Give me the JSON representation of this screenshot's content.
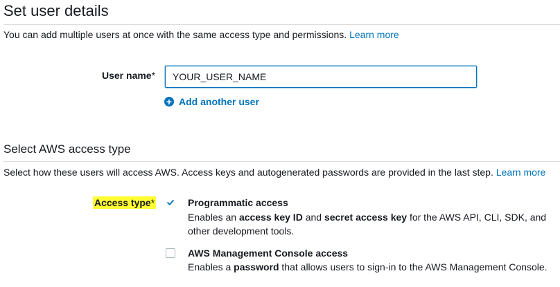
{
  "section1": {
    "title": "Set user details",
    "description": "You can add multiple users at once with the same access type and permissions.",
    "learn_more": "Learn more"
  },
  "user_name": {
    "label": "User name",
    "required_mark": "*",
    "value": "YOUR_USER_NAME"
  },
  "add_user": {
    "label": "Add another user",
    "icon": "plus-circle-icon"
  },
  "section2": {
    "title": "Select AWS access type",
    "description": "Select how these users will access AWS. Access keys and autogenerated passwords are provided in the last step.",
    "learn_more": "Learn more"
  },
  "access_type": {
    "label": "Access type",
    "required_mark": "*",
    "highlight_color": "#ffff33"
  },
  "options": [
    {
      "title": "Programmatic access",
      "checked": true,
      "desc_parts": [
        "Enables an ",
        "access key ID",
        " and ",
        "secret access key",
        " for the AWS API, CLI, SDK, and",
        "other development tools."
      ]
    },
    {
      "title": "AWS Management Console access",
      "checked": false,
      "desc_parts": [
        "Enables a ",
        "password",
        " that allows users to sign-in to the AWS Management Console."
      ]
    }
  ],
  "colors": {
    "link": "#0073bb",
    "text": "#16191f",
    "checkmark": "#0073bb"
  }
}
